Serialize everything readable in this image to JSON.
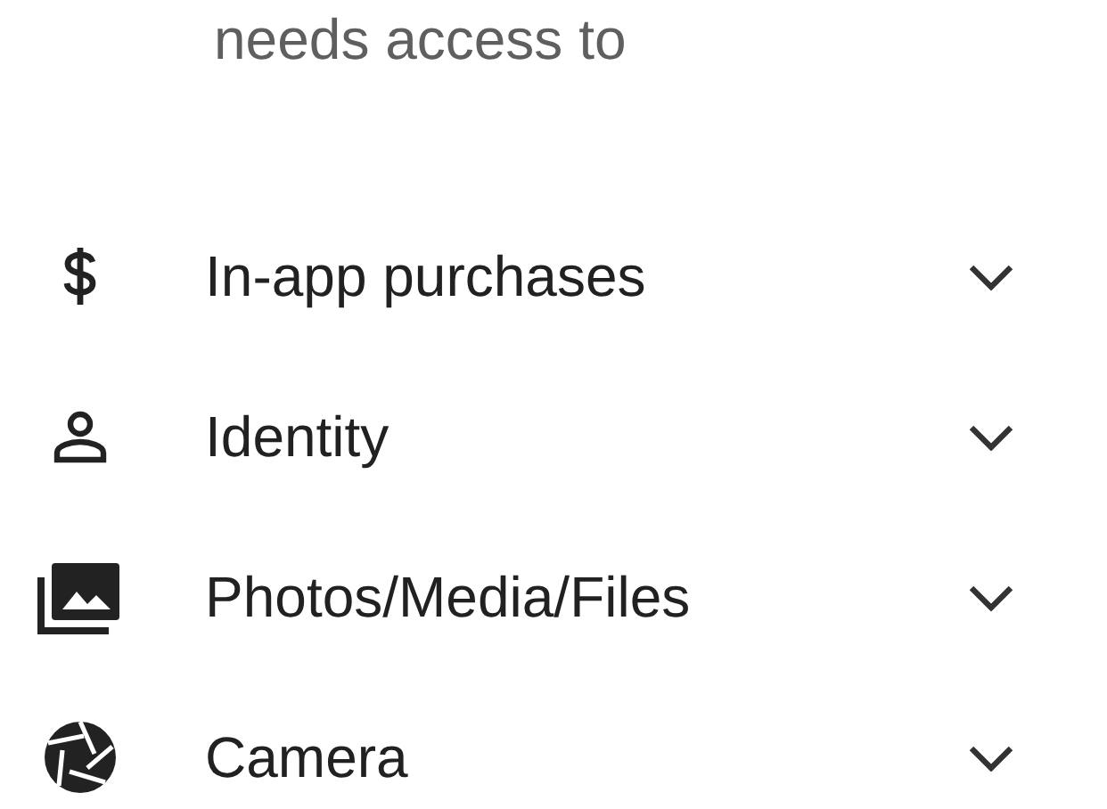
{
  "header": {
    "text": "needs access to"
  },
  "permissions": [
    {
      "kind": "purchases",
      "label": "In-app purchases",
      "expanded": false
    },
    {
      "kind": "identity",
      "label": "Identity",
      "expanded": false
    },
    {
      "kind": "media",
      "label": "Photos/Media/Files",
      "expanded": false
    },
    {
      "kind": "camera",
      "label": "Camera",
      "expanded": false
    }
  ]
}
